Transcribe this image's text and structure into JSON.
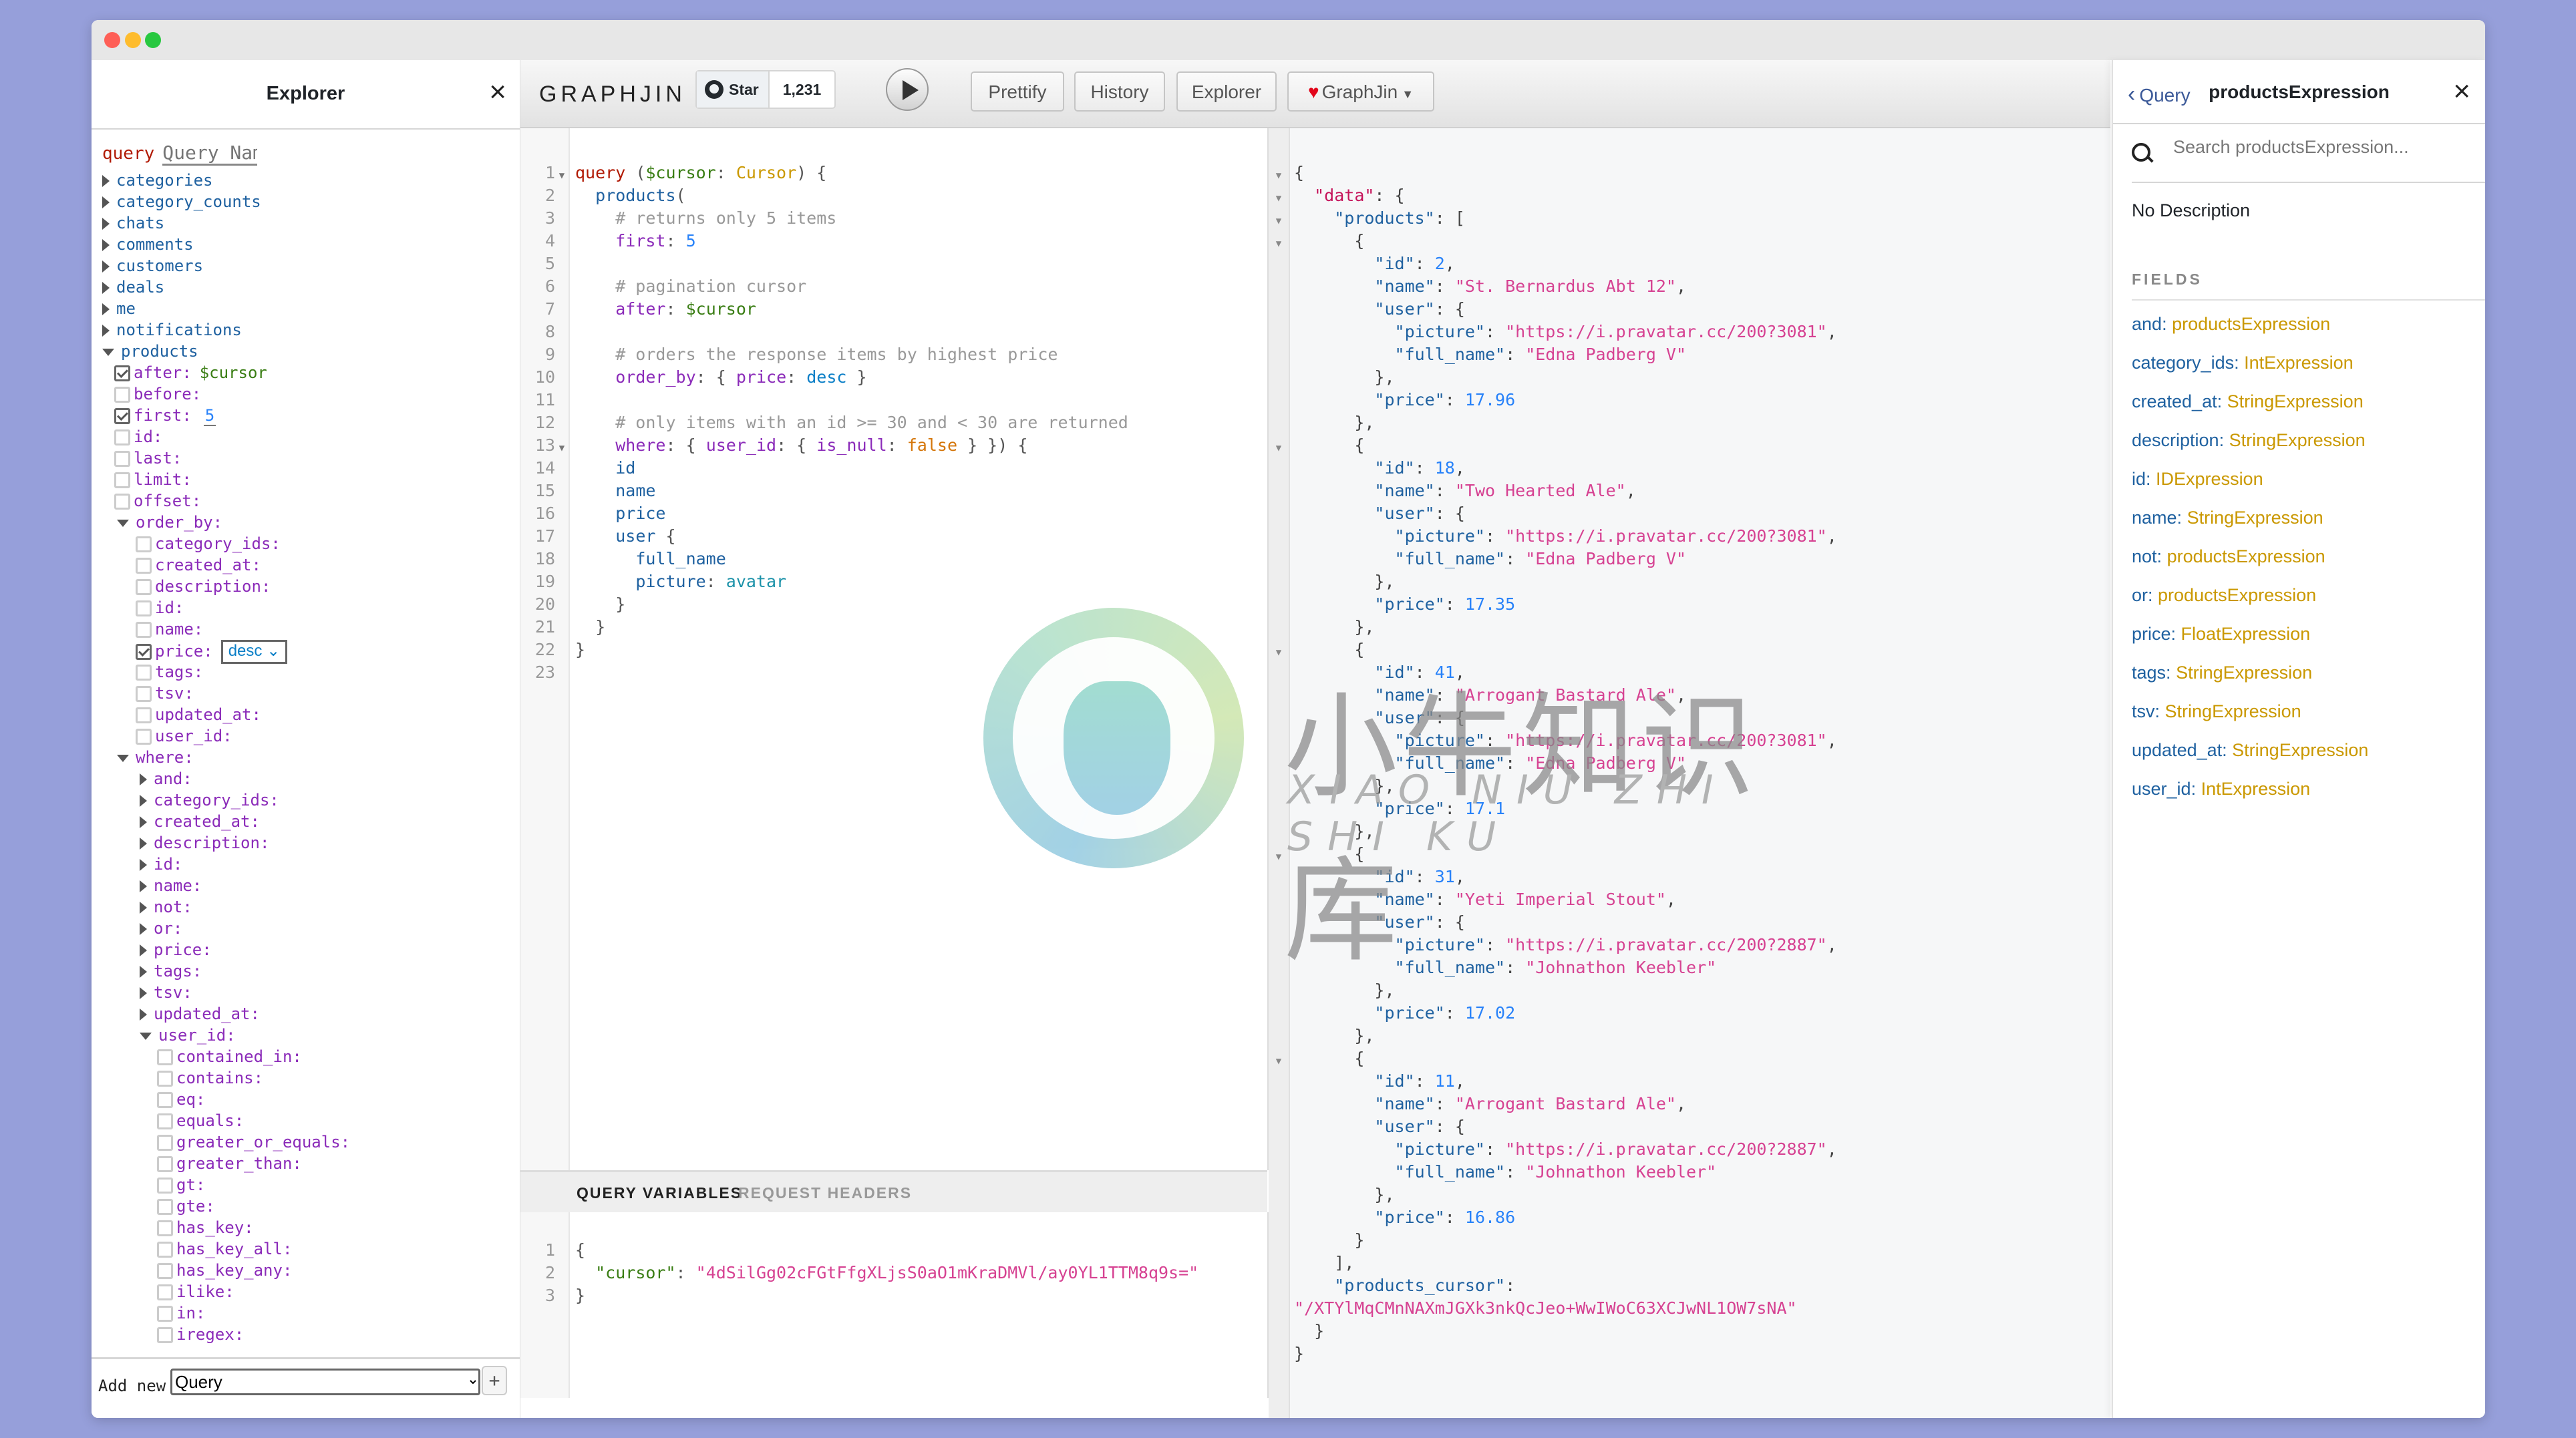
{
  "window": {
    "traffic_lights": [
      "close",
      "minimize",
      "zoom"
    ]
  },
  "explorer": {
    "title": "Explorer",
    "close_icon": "close-icon",
    "query_keyword": "query",
    "query_name_placeholder": "Query Name",
    "root_fields": [
      {
        "label": "categories",
        "expanded": false
      },
      {
        "label": "category_counts",
        "expanded": false
      },
      {
        "label": "chats",
        "expanded": false
      },
      {
        "label": "comments",
        "expanded": false
      },
      {
        "label": "customers",
        "expanded": false
      },
      {
        "label": "deals",
        "expanded": false
      },
      {
        "label": "me",
        "expanded": false
      },
      {
        "label": "notifications",
        "expanded": false
      },
      {
        "label": "products",
        "expanded": true
      }
    ],
    "products_args": [
      {
        "label": "after:",
        "checked": true,
        "value": "$cursor",
        "value_kind": "variable"
      },
      {
        "label": "before:",
        "checked": false
      },
      {
        "label": "first:",
        "checked": true,
        "value": "5",
        "value_kind": "number"
      },
      {
        "label": "id:",
        "checked": false
      },
      {
        "label": "last:",
        "checked": false
      },
      {
        "label": "limit:",
        "checked": false
      },
      {
        "label": "offset:",
        "checked": false
      }
    ],
    "order_by": {
      "label": "order_by:",
      "items": [
        {
          "label": "category_ids:",
          "checked": false
        },
        {
          "label": "created_at:",
          "checked": false
        },
        {
          "label": "description:",
          "checked": false
        },
        {
          "label": "id:",
          "checked": false
        },
        {
          "label": "name:",
          "checked": false
        },
        {
          "label": "price:",
          "checked": true,
          "select": "desc"
        },
        {
          "label": "tags:",
          "checked": false
        },
        {
          "label": "tsv:",
          "checked": false
        },
        {
          "label": "updated_at:",
          "checked": false
        },
        {
          "label": "user_id:",
          "checked": false
        }
      ]
    },
    "where": {
      "label": "where:",
      "items": [
        "and:",
        "category_ids:",
        "created_at:",
        "description:",
        "id:",
        "name:",
        "not:",
        "or:",
        "price:",
        "tags:",
        "tsv:",
        "updated_at:"
      ],
      "user_id": {
        "label": "user_id:",
        "items": [
          "contained_in:",
          "contains:",
          "eq:",
          "equals:",
          "greater_or_equals:",
          "greater_than:",
          "gt:",
          "gte:",
          "has_key:",
          "has_key_all:",
          "has_key_any:",
          "ilike:",
          "in:",
          "iregex:"
        ]
      }
    },
    "footer": {
      "add_new_label": "Add new",
      "selected_operation": "Query",
      "add_button": "+"
    }
  },
  "toolbar": {
    "logo": "GRAPHJIN",
    "github_star_label": "Star",
    "github_star_count": "1,231",
    "execute_icon": "play-icon",
    "prettify": "Prettify",
    "history": "History",
    "explorer": "Explorer",
    "graphjin_menu": "GraphJin"
  },
  "query_editor": {
    "lines": [
      [
        [
          "t-kw",
          "query"
        ],
        [
          "t-punc",
          " ("
        ],
        [
          "t-var",
          "$cursor"
        ],
        [
          "t-punc",
          ": "
        ],
        [
          "t-type",
          "Cursor"
        ],
        [
          "t-punc",
          ") {"
        ]
      ],
      [
        [
          "t-punc",
          "  "
        ],
        [
          "t-field",
          "products"
        ],
        [
          "t-punc",
          "("
        ]
      ],
      [
        [
          "t-com",
          "    # returns only 5 items"
        ]
      ],
      [
        [
          "t-punc",
          "    "
        ],
        [
          "t-arg",
          "first"
        ],
        [
          "t-punc",
          ": "
        ],
        [
          "t-num",
          "5"
        ]
      ],
      [],
      [
        [
          "t-com",
          "    # pagination cursor"
        ]
      ],
      [
        [
          "t-punc",
          "    "
        ],
        [
          "t-arg",
          "after"
        ],
        [
          "t-punc",
          ": "
        ],
        [
          "t-var",
          "$cursor"
        ]
      ],
      [],
      [
        [
          "t-com",
          "    # orders the response items by highest price"
        ]
      ],
      [
        [
          "t-punc",
          "    "
        ],
        [
          "t-arg",
          "order_by"
        ],
        [
          "t-punc",
          ": { "
        ],
        [
          "t-arg",
          "price"
        ],
        [
          "t-punc",
          ": "
        ],
        [
          "t-enum",
          "desc"
        ],
        [
          "t-punc",
          " }"
        ]
      ],
      [],
      [
        [
          "t-com",
          "    # only items with an id >= 30 and < 30 are returned"
        ]
      ],
      [
        [
          "t-punc",
          "    "
        ],
        [
          "t-arg",
          "where"
        ],
        [
          "t-punc",
          ": { "
        ],
        [
          "t-arg",
          "user_id"
        ],
        [
          "t-punc",
          ": { "
        ],
        [
          "t-arg",
          "is_null"
        ],
        [
          "t-punc",
          ": "
        ],
        [
          "t-bool",
          "false"
        ],
        [
          "t-punc",
          " } }) {"
        ]
      ],
      [
        [
          "t-punc",
          "    "
        ],
        [
          "t-field",
          "id"
        ]
      ],
      [
        [
          "t-punc",
          "    "
        ],
        [
          "t-field",
          "name"
        ]
      ],
      [
        [
          "t-punc",
          "    "
        ],
        [
          "t-field",
          "price"
        ]
      ],
      [
        [
          "t-punc",
          "    "
        ],
        [
          "t-field",
          "user"
        ],
        [
          "t-punc",
          " {"
        ]
      ],
      [
        [
          "t-punc",
          "      "
        ],
        [
          "t-field",
          "full_name"
        ]
      ],
      [
        [
          "t-punc",
          "      "
        ],
        [
          "t-field",
          "picture"
        ],
        [
          "t-punc",
          ": "
        ],
        [
          "t-alias",
          "avatar"
        ]
      ],
      [
        [
          "t-punc",
          "    }"
        ]
      ],
      [
        [
          "t-punc",
          "  }"
        ]
      ],
      [
        [
          "t-punc",
          "}"
        ]
      ],
      []
    ],
    "fold_lines": [
      1,
      13
    ]
  },
  "variables_panel": {
    "tabs": [
      {
        "label": "QUERY VARIABLES",
        "active": true
      },
      {
        "label": "REQUEST HEADERS",
        "active": false
      }
    ],
    "lines": [
      [
        [
          "t-punc",
          "{"
        ]
      ],
      [
        [
          "t-punc",
          "  "
        ],
        [
          "t-key",
          "\"cursor\""
        ],
        [
          "t-punc",
          ": "
        ],
        [
          "t-str",
          "\"4dSilGg02cFGtFfgXLjsS0aO1mKraDMVl/ay0YL1TTM8q9s=\""
        ]
      ],
      [
        [
          "t-punc",
          "}"
        ]
      ]
    ]
  },
  "result": {
    "products": [
      {
        "id": 2,
        "name": "St. Bernardus Abt 12",
        "picture": "https://i.pravatar.cc/200?3081",
        "full_name": "Edna Padberg V",
        "price": "17.96"
      },
      {
        "id": 18,
        "name": "Two Hearted Ale",
        "picture": "https://i.pravatar.cc/200?3081",
        "full_name": "Edna Padberg V",
        "price": "17.35"
      },
      {
        "id": 41,
        "name": "Arrogant Bastard Ale",
        "picture": "https://i.pravatar.cc/200?3081",
        "full_name": "Edna Padberg V",
        "price": "17.1"
      },
      {
        "id": 31,
        "name": "Yeti Imperial Stout",
        "picture": "https://i.pravatar.cc/200?2887",
        "full_name": "Johnathon Keebler",
        "price": "17.02"
      },
      {
        "id": 11,
        "name": "Arrogant Bastard Ale",
        "picture": "https://i.pravatar.cc/200?2887",
        "full_name": "Johnathon Keebler",
        "price": "16.86"
      }
    ],
    "products_cursor": "/XTYlMqCMnNAXmJGXk3nkQcJeo+WwIWoC63XCJwNL1OW7sNA"
  },
  "docs": {
    "back_label": "Query",
    "title": "productsExpression",
    "search_placeholder": "Search productsExpression...",
    "description": "No Description",
    "fields_label": "FIELDS",
    "fields": [
      {
        "name": "and",
        "type": "productsExpression"
      },
      {
        "name": "category_ids",
        "type": "IntExpression"
      },
      {
        "name": "created_at",
        "type": "StringExpression"
      },
      {
        "name": "description",
        "type": "StringExpression"
      },
      {
        "name": "id",
        "type": "IDExpression"
      },
      {
        "name": "name",
        "type": "StringExpression"
      },
      {
        "name": "not",
        "type": "productsExpression"
      },
      {
        "name": "or",
        "type": "productsExpression"
      },
      {
        "name": "price",
        "type": "FloatExpression"
      },
      {
        "name": "tags",
        "type": "StringExpression"
      },
      {
        "name": "tsv",
        "type": "StringExpression"
      },
      {
        "name": "updated_at",
        "type": "StringExpression"
      },
      {
        "name": "user_id",
        "type": "IntExpression"
      }
    ]
  },
  "watermark": {
    "chinese": "小牛知识库",
    "pinyin": "XIAO NIU ZHI SHI KU"
  }
}
